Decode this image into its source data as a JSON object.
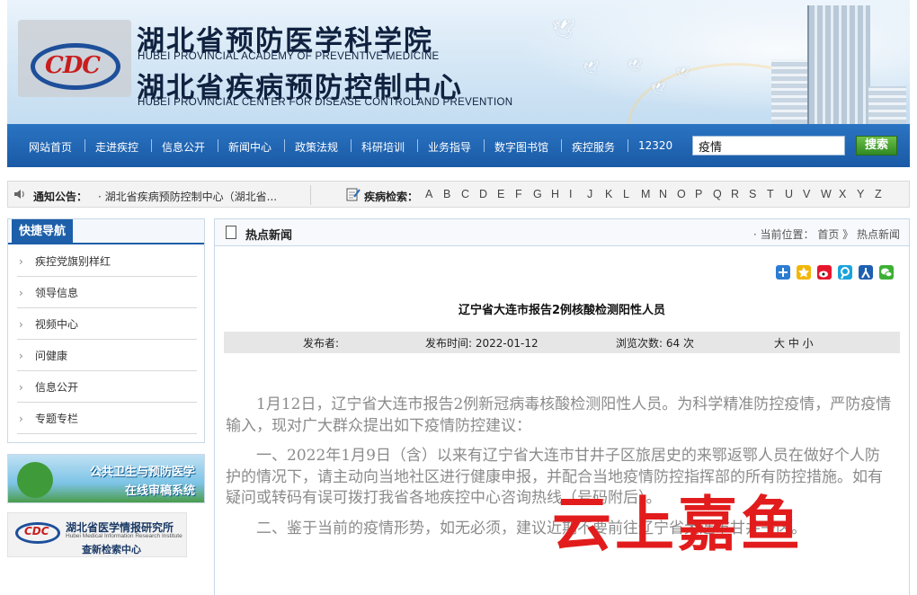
{
  "header": {
    "title_cn_1": "湖北省预防医学科学院",
    "title_en_1": "HUBEI PROVINCIAL ACADEMY OF PREVENTIVE MEDICINE",
    "title_cn_2": "湖北省疾病预防控制中心",
    "title_en_2": "HUBEI PROVINCIAL CENTER FOR DISEASE CONTROLAND PREVENTION",
    "logo_text": "CDC"
  },
  "nav": {
    "items": [
      "网站首页",
      "走进疾控",
      "信息公开",
      "新闻中心",
      "政策法规",
      "科研培训",
      "业务指导",
      "数字图书馆",
      "疾控服务",
      "12320"
    ],
    "search_value": "疫情",
    "search_button": "搜索"
  },
  "notice": {
    "label": "通知公告：",
    "text": "· 湖北省疾病预防控制中心（湖北省...",
    "disease_label": "疾病检索：",
    "letters": [
      "A",
      "B",
      "C",
      "D",
      "E",
      "F",
      "G",
      "H",
      "I",
      "J",
      "K",
      "L",
      "M",
      "N",
      "O",
      "P",
      "Q",
      "R",
      "S",
      "T",
      "U",
      "V",
      "W",
      "X",
      "Y",
      "Z"
    ]
  },
  "sidebar": {
    "title": "快捷导航",
    "items": [
      "疾控党旗别样红",
      "领导信息",
      "视频中心",
      "问健康",
      "信息公开",
      "专题专栏"
    ],
    "ad1_line1": "公共卫生与预防医学",
    "ad1_line2": "在线审稿系统",
    "ad2_line1": "湖北省医学情报研究所",
    "ad2_line2": "Hubei Medical Information Research Institute",
    "ad2_line3": "查新检索中心"
  },
  "main": {
    "section_title": "热点新闻",
    "breadcrumb": "· 当前位置： 首页 》 热点新闻",
    "share_icons": [
      "plus-icon",
      "qzone-icon",
      "weibo-icon",
      "tencent-weibo-icon",
      "renren-icon",
      "wechat-icon"
    ],
    "article_title": "辽宁省大连市报告2例核酸检测阳性人员",
    "meta": {
      "publisher": "发布者:",
      "time": "发布时间: 2022-01-12",
      "views": "浏览次数: 64 次",
      "size_controls": "大 中 小"
    },
    "paragraphs": [
      "1月12日，辽宁省大连市报告2例新冠病毒核酸检测阳性人员。为科学精准防控疫情，严防疫情输入，现对广大群众提出如下疫情防控建议：",
      "一、2022年1月9日（含）以来有辽宁省大连市甘井子区旅居史的来鄂返鄂人员在做好个人防护的情况下，请主动向当地社区进行健康申报，并配合当地疫情防控指挥部的所有防控措施。如有疑问或转码有误可拨打我省各地疾控中心咨询热线（号码附后）。",
      "二、鉴于当前的疫情形势，如无必须，建议近期不要前往辽宁省大连市甘井子区。"
    ]
  },
  "watermark": "云上嘉鱼",
  "colors": {
    "nav_blue": "#1a5aa6",
    "search_green": "#2f8a22",
    "watermark_red": "#e21c1c"
  }
}
